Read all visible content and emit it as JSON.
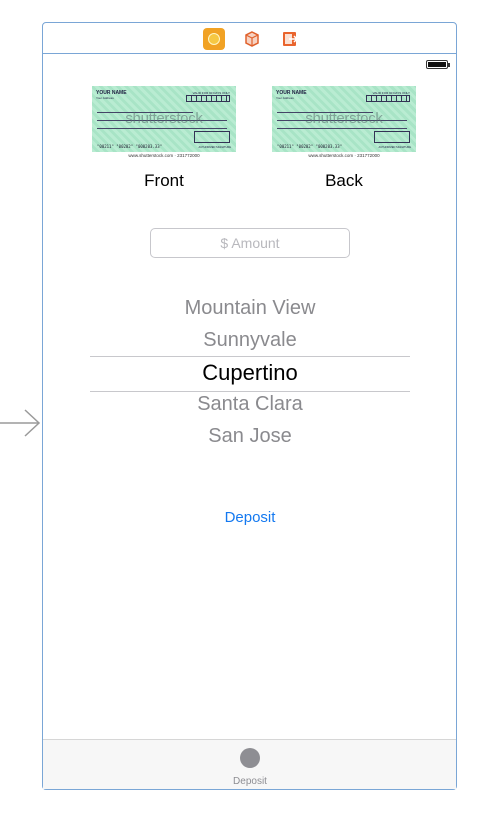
{
  "scene_dock": {
    "icons": [
      "view-controller-icon",
      "first-responder-icon",
      "exit-icon"
    ]
  },
  "status_bar": {
    "icon": "battery-icon"
  },
  "checks": {
    "front": {
      "label": "Front",
      "name": "YOUR NAME",
      "address": "Your Address",
      "valid_text": "VALID FOR 90 DAYS ONLY",
      "micr": "\"00211\" \"00202\" \"000203.33\"",
      "signature_text": "AUTHORIZED SIGNATURE",
      "watermark": "shutterstock",
      "credit": "www.shutterstock.com · 231772000"
    },
    "back": {
      "label": "Back",
      "name": "YOUR NAME",
      "address": "Your Address",
      "valid_text": "VALID FOR 90 DAYS ONLY",
      "micr": "\"00211\" \"00202\" \"000203.33\"",
      "signature_text": "AUTHORIZED SIGNATURE",
      "watermark": "shutterstock",
      "credit": "www.shutterstock.com · 231772000"
    }
  },
  "amount": {
    "placeholder": "$ Amount",
    "value": ""
  },
  "picker": {
    "items": [
      "Mountain View",
      "Sunnyvale",
      "Cupertino",
      "Santa Clara",
      "San Jose"
    ],
    "selected_index": 2
  },
  "deposit_button": {
    "label": "Deposit"
  },
  "tab_bar": {
    "items": [
      {
        "label": "Deposit",
        "icon": "circle-icon"
      }
    ]
  },
  "colors": {
    "scene_border": "#7aa6d6",
    "tint": "#1479f0",
    "check_paper": "#b9ecd2",
    "picker_inactive": "#8a8a8e"
  }
}
